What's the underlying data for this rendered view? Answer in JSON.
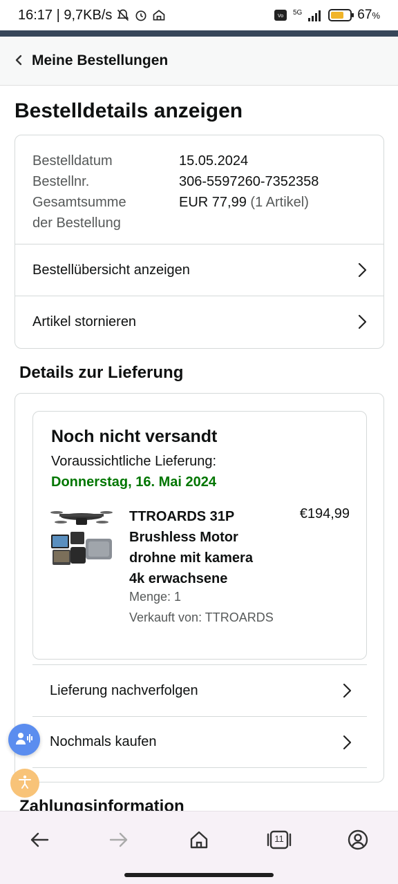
{
  "status_bar": {
    "time_speed": "16:17 | 9,7KB/s",
    "network": "5G",
    "battery_percent": "67",
    "battery_unit": "%",
    "battery_level": 0.67,
    "icons": [
      "bell-off-icon",
      "alarm-icon",
      "home-network-icon",
      "volte-icon",
      "signal-icon",
      "battery-icon"
    ]
  },
  "header": {
    "back_label": "Meine Bestellungen"
  },
  "page": {
    "title": "Bestelldetails anzeigen"
  },
  "order": {
    "date_label": "Bestelldatum",
    "date_value": "15.05.2024",
    "number_label": "Bestellnr.",
    "number_value": "306-5597260-7352358",
    "total_label_1": "Gesamtsumme",
    "total_label_2": "der Bestellung",
    "total_value": "EUR 77,99",
    "total_items": "(1 Artikel)",
    "links": [
      {
        "label": "Bestellübersicht anzeigen"
      },
      {
        "label": "Artikel stornieren"
      }
    ]
  },
  "delivery": {
    "section_title": "Details zur Lieferung",
    "status": "Noch nicht versandt",
    "eta_label": "Voraussichtliche Lieferung:",
    "eta_date": "Donnerstag, 16. Mai 2024",
    "product": {
      "title_lines": [
        "TTROARDS 31P",
        "Brushless Motor",
        "drohne mit kamera",
        "4k erwachsene"
      ],
      "price": "€194,99",
      "quantity": "Menge: 1",
      "seller": "Verkauft von: TTROARDS"
    },
    "links": [
      {
        "label": "Lieferung nachverfolgen"
      },
      {
        "label": "Nochmals kaufen"
      }
    ]
  },
  "next_section": {
    "title": "Zahlungsinformation"
  },
  "bottom_bar": {
    "tab_count": "11"
  },
  "colors": {
    "delivery_green": "#007600",
    "header_strip": "#37475a",
    "voice_button": "#5b8def",
    "accessibility_button": "#f8c378"
  }
}
